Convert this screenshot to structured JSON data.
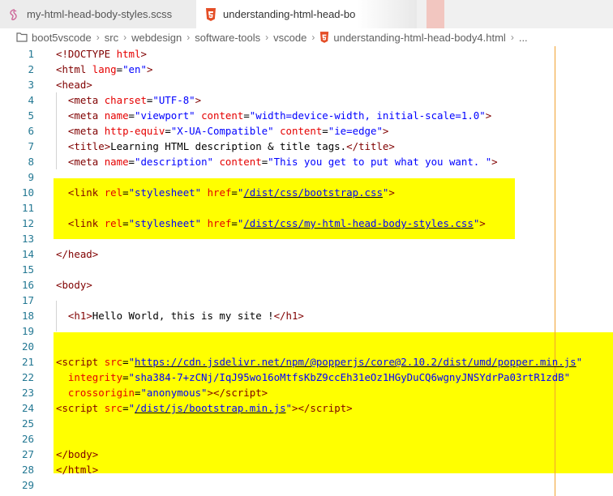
{
  "tabs": [
    {
      "label": "my-html-head-body-styles.scss",
      "icon": "sass-icon",
      "active": false
    },
    {
      "label": "understanding-html-head-bo",
      "icon": "html5-icon",
      "active": true
    }
  ],
  "breadcrumb": [
    "boot5vscode",
    "src",
    "webdesign",
    "software-tools",
    "vscode",
    "understanding-html-head-body4.html",
    "..."
  ],
  "colors": {
    "highlight": "#ffff00",
    "ruler": "#f0a030",
    "line_numbers": "#237893",
    "tag": "#800000",
    "attr": "#e50000",
    "string": "#0000ff"
  },
  "lines": [
    {
      "n": "1",
      "tokens": [
        [
          "punct",
          "<!"
        ],
        [
          "tag",
          "DOCTYPE"
        ],
        [
          "text",
          " "
        ],
        [
          "attr",
          "html"
        ],
        [
          "punct",
          ">"
        ]
      ]
    },
    {
      "n": "2",
      "tokens": [
        [
          "punct",
          "<"
        ],
        [
          "tag",
          "html"
        ],
        [
          "text",
          " "
        ],
        [
          "attr",
          "lang"
        ],
        [
          "text",
          "="
        ],
        [
          "str",
          "\"en\""
        ],
        [
          "punct",
          ">"
        ]
      ]
    },
    {
      "n": "3",
      "tokens": [
        [
          "punct",
          "<"
        ],
        [
          "tag",
          "head"
        ],
        [
          "punct",
          ">"
        ]
      ]
    },
    {
      "n": "4",
      "tokens": [
        [
          "text",
          "  "
        ],
        [
          "punct",
          "<"
        ],
        [
          "tag",
          "meta"
        ],
        [
          "text",
          " "
        ],
        [
          "attr",
          "charset"
        ],
        [
          "text",
          "="
        ],
        [
          "str",
          "\"UTF-8\""
        ],
        [
          "punct",
          ">"
        ]
      ]
    },
    {
      "n": "5",
      "tokens": [
        [
          "text",
          "  "
        ],
        [
          "punct",
          "<"
        ],
        [
          "tag",
          "meta"
        ],
        [
          "text",
          " "
        ],
        [
          "attr",
          "name"
        ],
        [
          "text",
          "="
        ],
        [
          "str",
          "\"viewport\""
        ],
        [
          "text",
          " "
        ],
        [
          "attr",
          "content"
        ],
        [
          "text",
          "="
        ],
        [
          "str",
          "\"width=device-width, initial-scale=1.0\""
        ],
        [
          "punct",
          ">"
        ]
      ]
    },
    {
      "n": "6",
      "tokens": [
        [
          "text",
          "  "
        ],
        [
          "punct",
          "<"
        ],
        [
          "tag",
          "meta"
        ],
        [
          "text",
          " "
        ],
        [
          "attr",
          "http-equiv"
        ],
        [
          "text",
          "="
        ],
        [
          "str",
          "\"X-UA-Compatible\""
        ],
        [
          "text",
          " "
        ],
        [
          "attr",
          "content"
        ],
        [
          "text",
          "="
        ],
        [
          "str",
          "\"ie=edge\""
        ],
        [
          "punct",
          ">"
        ]
      ]
    },
    {
      "n": "7",
      "tokens": [
        [
          "text",
          "  "
        ],
        [
          "punct",
          "<"
        ],
        [
          "tag",
          "title"
        ],
        [
          "punct",
          ">"
        ],
        [
          "text",
          "Learning HTML description & title tags."
        ],
        [
          "punct",
          "</"
        ],
        [
          "tag",
          "title"
        ],
        [
          "punct",
          ">"
        ]
      ]
    },
    {
      "n": "8",
      "tokens": [
        [
          "text",
          "  "
        ],
        [
          "punct",
          "<"
        ],
        [
          "tag",
          "meta"
        ],
        [
          "text",
          " "
        ],
        [
          "attr",
          "name"
        ],
        [
          "text",
          "="
        ],
        [
          "str",
          "\"description\""
        ],
        [
          "text",
          " "
        ],
        [
          "attr",
          "content"
        ],
        [
          "text",
          "="
        ],
        [
          "str",
          "\"This you get to put what you want. \""
        ],
        [
          "punct",
          ">"
        ]
      ]
    },
    {
      "n": "9",
      "tokens": []
    },
    {
      "n": "10",
      "tokens": [
        [
          "text",
          "  "
        ],
        [
          "punct",
          "<"
        ],
        [
          "tag",
          "link"
        ],
        [
          "text",
          " "
        ],
        [
          "attr",
          "rel"
        ],
        [
          "text",
          "="
        ],
        [
          "str",
          "\"stylesheet\""
        ],
        [
          "text",
          " "
        ],
        [
          "attr",
          "href"
        ],
        [
          "text",
          "="
        ],
        [
          "str",
          "\""
        ],
        [
          "link",
          "/dist/css/bootstrap.css"
        ],
        [
          "str",
          "\""
        ],
        [
          "punct",
          ">"
        ]
      ]
    },
    {
      "n": "11",
      "tokens": []
    },
    {
      "n": "12",
      "tokens": [
        [
          "text",
          "  "
        ],
        [
          "punct",
          "<"
        ],
        [
          "tag",
          "link"
        ],
        [
          "text",
          " "
        ],
        [
          "attr",
          "rel"
        ],
        [
          "text",
          "="
        ],
        [
          "str",
          "\"stylesheet\""
        ],
        [
          "text",
          " "
        ],
        [
          "attr",
          "href"
        ],
        [
          "text",
          "="
        ],
        [
          "str",
          "\""
        ],
        [
          "link",
          "/dist/css/my-html-head-body-styles.css"
        ],
        [
          "str",
          "\""
        ],
        [
          "punct",
          ">"
        ]
      ]
    },
    {
      "n": "13",
      "tokens": []
    },
    {
      "n": "14",
      "tokens": [
        [
          "punct",
          "</"
        ],
        [
          "tag",
          "head"
        ],
        [
          "punct",
          ">"
        ]
      ]
    },
    {
      "n": "15",
      "tokens": []
    },
    {
      "n": "16",
      "tokens": [
        [
          "punct",
          "<"
        ],
        [
          "tag",
          "body"
        ],
        [
          "punct",
          ">"
        ]
      ]
    },
    {
      "n": "17",
      "tokens": []
    },
    {
      "n": "18",
      "tokens": [
        [
          "text",
          "  "
        ],
        [
          "punct",
          "<"
        ],
        [
          "tag",
          "h1"
        ],
        [
          "punct",
          ">"
        ],
        [
          "text",
          "Hello World, this is my site !"
        ],
        [
          "punct",
          "</"
        ],
        [
          "tag",
          "h1"
        ],
        [
          "punct",
          ">"
        ]
      ]
    },
    {
      "n": "19",
      "tokens": []
    },
    {
      "n": "20",
      "tokens": []
    },
    {
      "n": "21",
      "tokens": [
        [
          "punct",
          "<"
        ],
        [
          "tag",
          "script"
        ],
        [
          "text",
          " "
        ],
        [
          "attr",
          "src"
        ],
        [
          "text",
          "="
        ],
        [
          "str",
          "\""
        ],
        [
          "link",
          "https://cdn.jsdelivr.net/npm/@popperjs/core@2.10.2/dist/umd/popper.min.js"
        ],
        [
          "str",
          "\""
        ]
      ]
    },
    {
      "n": "22",
      "tokens": [
        [
          "text",
          "  "
        ],
        [
          "attr",
          "integrity"
        ],
        [
          "text",
          "="
        ],
        [
          "str",
          "\"sha384-7+zCNj/IqJ95wo16oMtfsKbZ9ccEh31eOz1HGyDuCQ6wgnyJNSYdrPa03rtR1zdB\""
        ]
      ]
    },
    {
      "n": "23",
      "tokens": [
        [
          "text",
          "  "
        ],
        [
          "attr",
          "crossorigin"
        ],
        [
          "text",
          "="
        ],
        [
          "str",
          "\"anonymous\""
        ],
        [
          "punct",
          ">"
        ],
        [
          "punct",
          "</"
        ],
        [
          "tag",
          "script"
        ],
        [
          "punct",
          ">"
        ]
      ]
    },
    {
      "n": "24",
      "tokens": [
        [
          "punct",
          "<"
        ],
        [
          "tag",
          "script"
        ],
        [
          "text",
          " "
        ],
        [
          "attr",
          "src"
        ],
        [
          "text",
          "="
        ],
        [
          "str",
          "\""
        ],
        [
          "link",
          "/dist/js/bootstrap.min.js"
        ],
        [
          "str",
          "\""
        ],
        [
          "punct",
          ">"
        ],
        [
          "punct",
          "</"
        ],
        [
          "tag",
          "script"
        ],
        [
          "punct",
          ">"
        ]
      ]
    },
    {
      "n": "25",
      "tokens": []
    },
    {
      "n": "26",
      "tokens": []
    },
    {
      "n": "27",
      "tokens": [
        [
          "punct",
          "</"
        ],
        [
          "tag",
          "body"
        ],
        [
          "punct",
          ">"
        ]
      ]
    },
    {
      "n": "28",
      "tokens": [
        [
          "punct",
          "</"
        ],
        [
          "tag",
          "html"
        ],
        [
          "punct",
          ">"
        ]
      ]
    },
    {
      "n": "29",
      "tokens": []
    }
  ]
}
